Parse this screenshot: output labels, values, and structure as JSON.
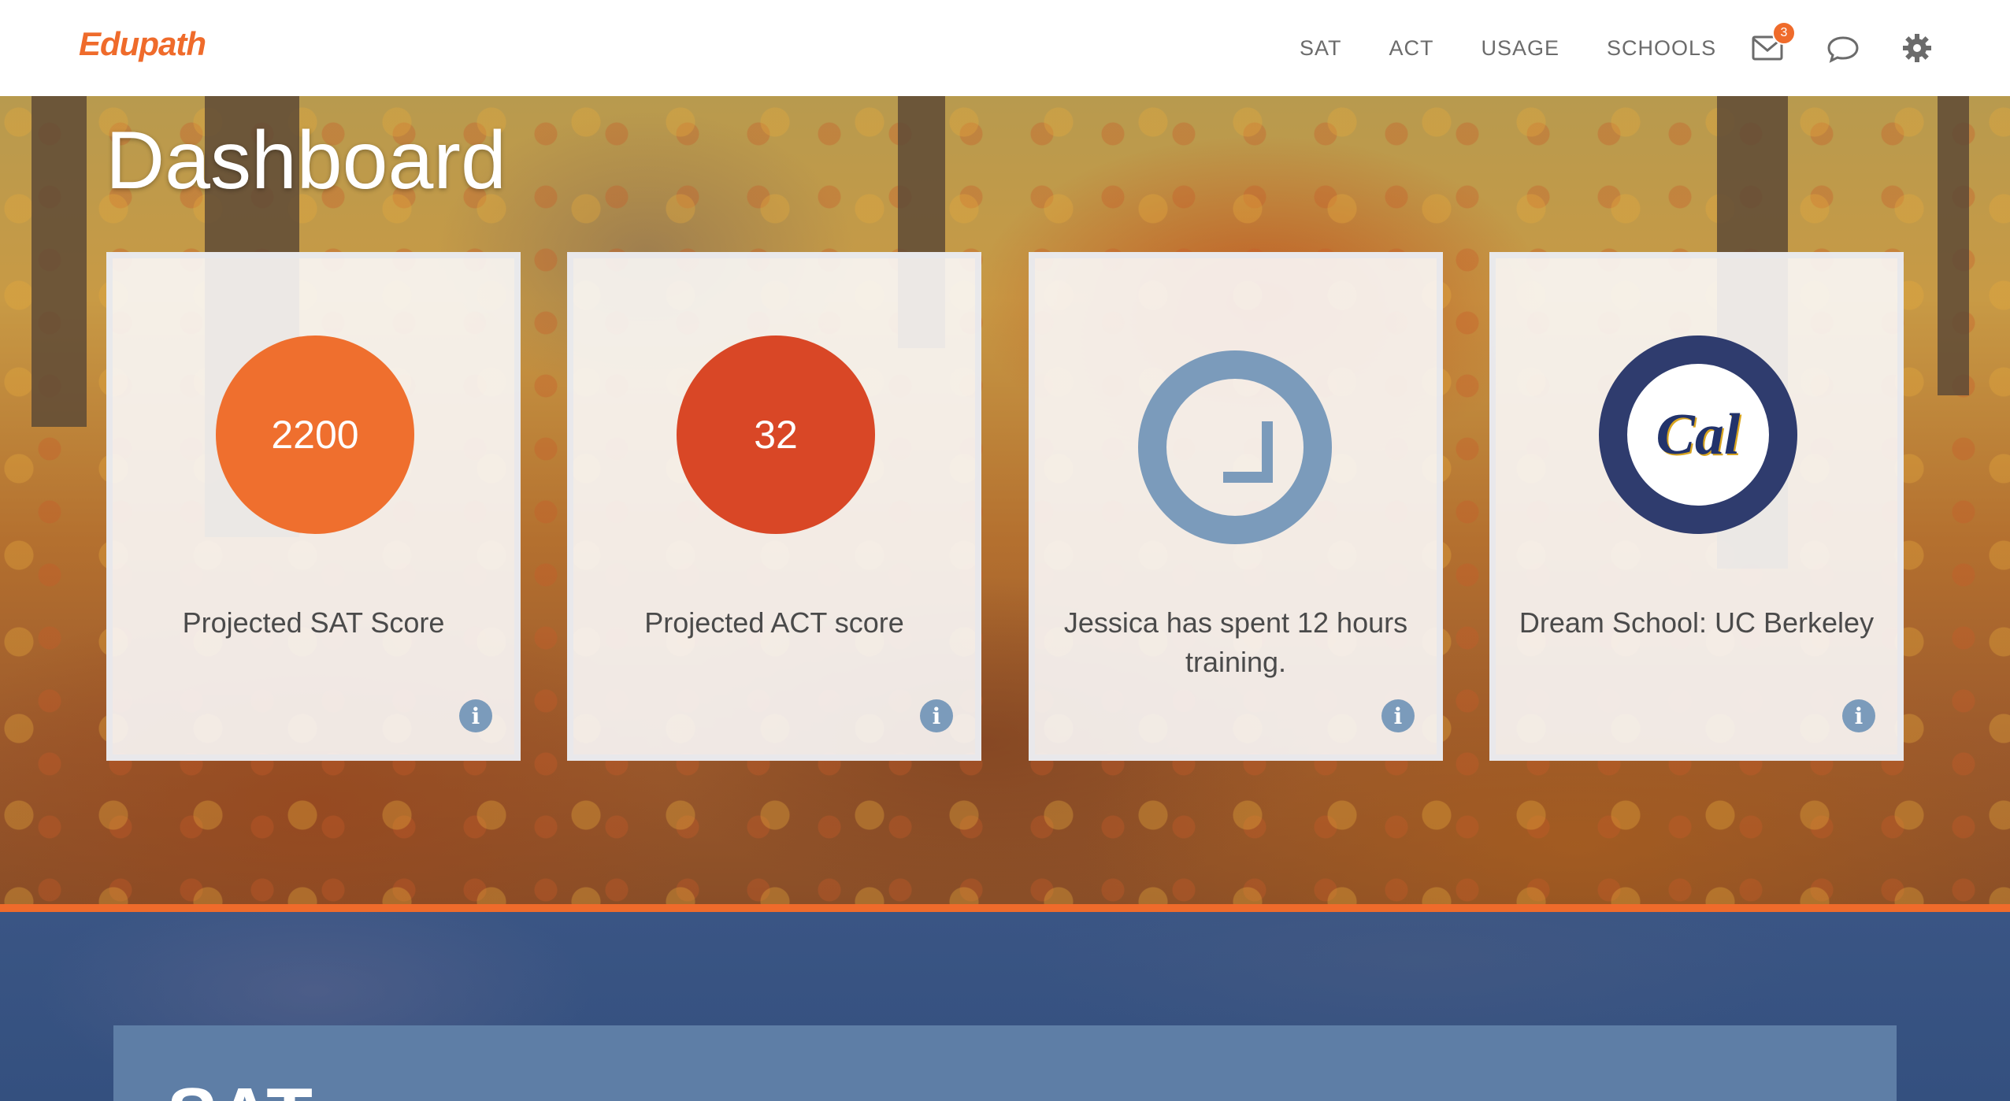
{
  "app": {
    "logo": "Edupath"
  },
  "nav": {
    "links": [
      "SAT",
      "ACT",
      "USAGE",
      "SCHOOLS"
    ],
    "mail_badge": "3",
    "icons": [
      "mail-icon",
      "chat-icon",
      "gear-icon"
    ]
  },
  "page": {
    "title": "Dashboard"
  },
  "cards": [
    {
      "value": "2200",
      "label": "Projected SAT Score",
      "color": "#ef6f2e"
    },
    {
      "value": "32",
      "label": "Projected ACT score",
      "color": "#d94726"
    },
    {
      "icon": "clock-icon",
      "label": "Jessica has spent 12 hours training.",
      "color": "#7b9bbb"
    },
    {
      "logo": "Cal",
      "label": "Dream School: UC Berkeley",
      "color": "#2f3c6e"
    }
  ],
  "info_icon": "i",
  "lower_section": {
    "title": "SAT"
  },
  "colors": {
    "accent": "#ef6b2b",
    "nav_text": "#6b6b6b",
    "info": "#7b9bbb"
  }
}
